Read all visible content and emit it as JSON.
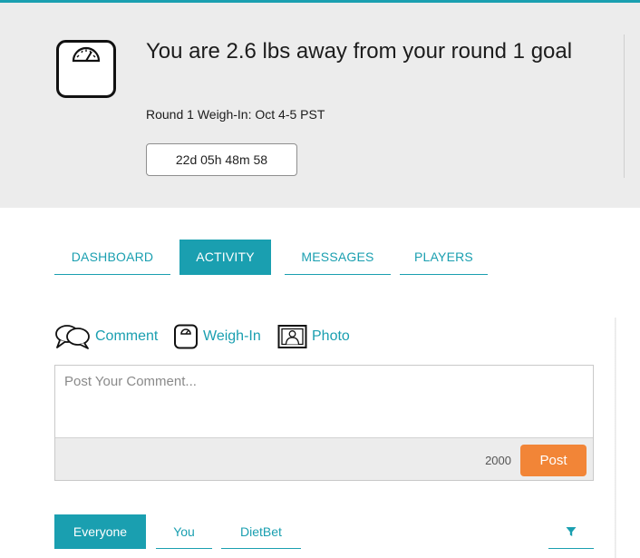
{
  "banner": {
    "goal_title": "You are 2.6 lbs away from your round 1 goal",
    "weighin_text": "Round 1 Weigh-In: Oct 4-5 PST",
    "countdown": "22d 05h 48m 58",
    "icon": "bathroom-scale-icon"
  },
  "tabs": [
    {
      "label": "DASHBOARD",
      "active": false
    },
    {
      "label": "ACTIVITY",
      "active": true
    },
    {
      "label": "MESSAGES",
      "active": false
    },
    {
      "label": "PLAYERS",
      "active": false
    }
  ],
  "post_types": [
    {
      "label": "Comment",
      "icon": "speech-bubbles-icon"
    },
    {
      "label": "Weigh-In",
      "icon": "scale-icon"
    },
    {
      "label": "Photo",
      "icon": "photo-icon"
    }
  ],
  "composer": {
    "placeholder": "Post Your Comment...",
    "value": "",
    "char_limit": "2000",
    "post_label": "Post"
  },
  "feed_filters": [
    {
      "label": "Everyone",
      "active": true
    },
    {
      "label": "You",
      "active": false
    },
    {
      "label": "DietBet",
      "active": false
    }
  ],
  "filter_icon": "funnel-icon",
  "colors": {
    "accent": "#1a9fb0",
    "post_button": "#f28537",
    "banner_bg": "#ececec"
  }
}
